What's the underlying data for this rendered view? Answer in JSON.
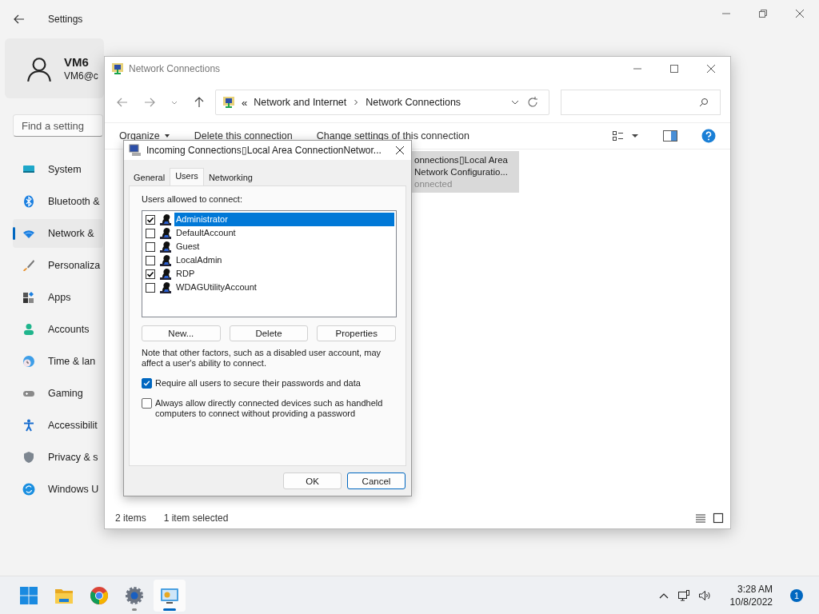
{
  "settings_window": {
    "title": "Settings",
    "account": {
      "name": "VM6",
      "email": "VM6@c"
    },
    "search": {
      "placeholder": "Find a setting"
    },
    "nav_items": [
      {
        "label": "System",
        "selected": false
      },
      {
        "label": "Bluetooth &",
        "selected": false
      },
      {
        "label": "Network &",
        "selected": true
      },
      {
        "label": "Personaliza",
        "selected": false
      },
      {
        "label": "Apps",
        "selected": false
      },
      {
        "label": "Accounts",
        "selected": false
      },
      {
        "label": "Time & lan",
        "selected": false
      },
      {
        "label": "Gaming",
        "selected": false
      },
      {
        "label": "Accessibilit",
        "selected": false
      },
      {
        "label": "Privacy & s",
        "selected": false
      },
      {
        "label": "Windows U",
        "selected": false
      }
    ]
  },
  "explorer_window": {
    "title": "Network Connections",
    "address": {
      "overflow": "«",
      "crumbs": [
        "Network and Internet",
        "Network Connections"
      ]
    },
    "toolbar": [
      "Organize",
      "Delete this connection",
      "Change settings of this connection"
    ],
    "items": [
      {
        "lines": [
          "onnections▯Local Area",
          "Network Configuratio...",
          "onnected"
        ],
        "selected": true
      }
    ],
    "status_bar": {
      "count": "2 items",
      "selection": "1 item selected"
    }
  },
  "dialog": {
    "title": "Incoming Connections▯Local Area ConnectionNetwor...",
    "tabs": [
      {
        "label": "General",
        "selected": false
      },
      {
        "label": "Users",
        "selected": true
      },
      {
        "label": "Networking",
        "selected": false
      }
    ],
    "list_label": "Users allowed to connect:",
    "users": [
      {
        "name": "Administrator",
        "checked": true,
        "selected": true
      },
      {
        "name": "DefaultAccount",
        "checked": false,
        "selected": false
      },
      {
        "name": "Guest",
        "checked": false,
        "selected": false
      },
      {
        "name": "LocalAdmin",
        "checked": false,
        "selected": false
      },
      {
        "name": "RDP",
        "checked": true,
        "selected": false
      },
      {
        "name": "WDAGUtilityAccount",
        "checked": false,
        "selected": false
      }
    ],
    "list_buttons": [
      "New...",
      "Delete",
      "Properties"
    ],
    "note": "Note that other factors, such as a disabled user account, may affect a user's ability to connect.",
    "options": [
      {
        "label": "Require all users to secure their passwords and data",
        "checked": true
      },
      {
        "label": "Always allow directly connected devices such as handheld computers to connect without providing a password",
        "checked": false
      }
    ],
    "buttons": [
      {
        "label": "OK",
        "kind": "plain"
      },
      {
        "label": "Cancel",
        "kind": "default"
      }
    ]
  },
  "taskbar": {
    "apps": [
      {
        "selected": false,
        "running": false
      },
      {
        "selected": false,
        "running": false
      },
      {
        "selected": false,
        "running": false
      },
      {
        "selected": false,
        "running": true
      },
      {
        "selected": true,
        "running": true
      }
    ],
    "time": "3:28 AM",
    "date": "10/8/2022",
    "notifications": "1"
  }
}
